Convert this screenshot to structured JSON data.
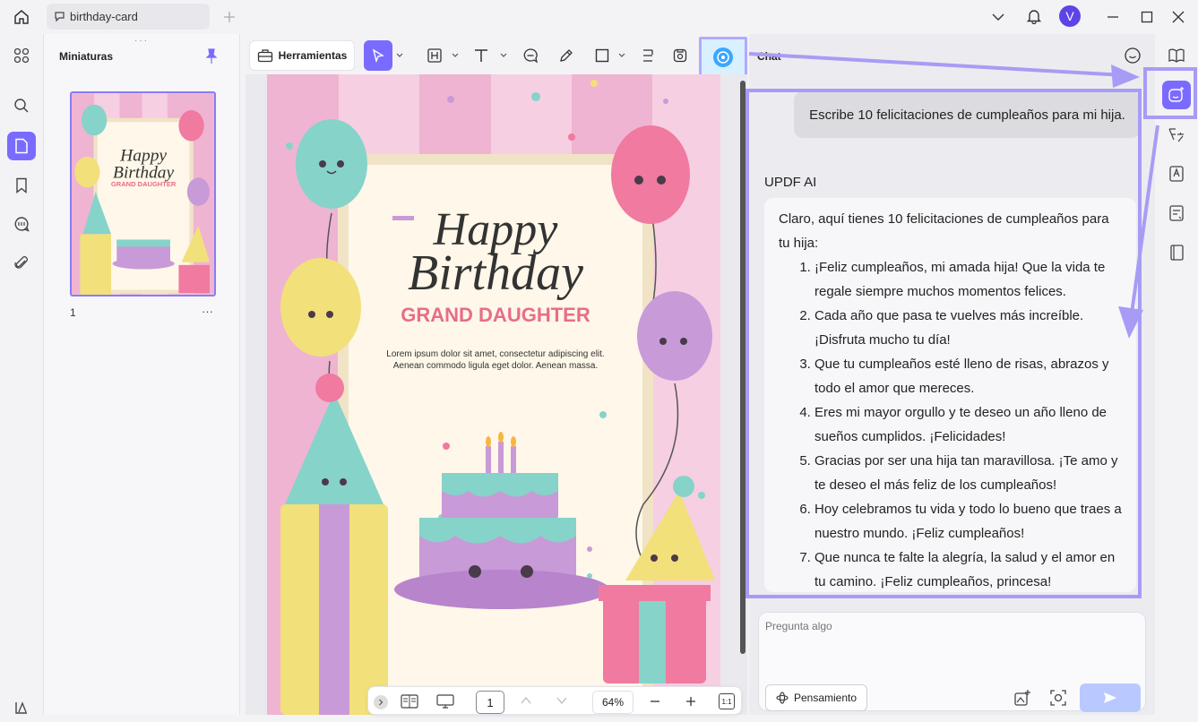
{
  "tab": {
    "title": "birthday-card"
  },
  "user": {
    "initial": "V"
  },
  "thumbnails": {
    "title": "Miniaturas",
    "page_number": "1",
    "more": "···"
  },
  "toolbar": {
    "tools_label": "Herramientas"
  },
  "document": {
    "heading_line1": "Happy",
    "heading_line2": "Birthday",
    "subheading": "GRAND DAUGHTER",
    "body_line1": "Lorem ipsum dolor sit amet, consectetur adipiscing elit.",
    "body_line2": "Aenean commodo ligula eget dolor. Aenean massa."
  },
  "pagebar": {
    "current_page": "1",
    "zoom": "64%",
    "fit_label": "1:1"
  },
  "chat": {
    "title": "Chat",
    "user_message": "Escribe 10 felicitaciones de cumpleaños para mi hija.",
    "ai_name": "UPDF AI",
    "ai_intro": "Claro, aquí tienes 10 felicitaciones de cumpleaños para tu hija:",
    "ai_items": [
      "¡Feliz cumpleaños, mi amada hija! Que la vida te regale siempre muchos momentos felices.",
      "Cada año que pasa te vuelves más increíble. ¡Disfruta mucho tu día!",
      "Que tu cumpleaños esté lleno de risas, abrazos y todo el amor que mereces.",
      "Eres mi mayor orgullo y te deseo un año lleno de sueños cumplidos. ¡Felicidades!",
      "Gracias por ser una hija tan maravillosa. ¡Te amo y te deseo el más feliz de los cumpleaños!",
      "Hoy celebramos tu vida y todo lo bueno que traes a nuestro mundo. ¡Feliz cumpleaños!",
      "Que nunca te falte la alegría, la salud y el amor en tu camino. ¡Feliz cumpleaños, princesa!"
    ],
    "input_placeholder": "Pregunta algo",
    "think_label": "Pensamiento"
  },
  "colors": {
    "accent": "#7a6bff",
    "highlight": "#a79cf5",
    "pink": "#f2c4dc"
  }
}
